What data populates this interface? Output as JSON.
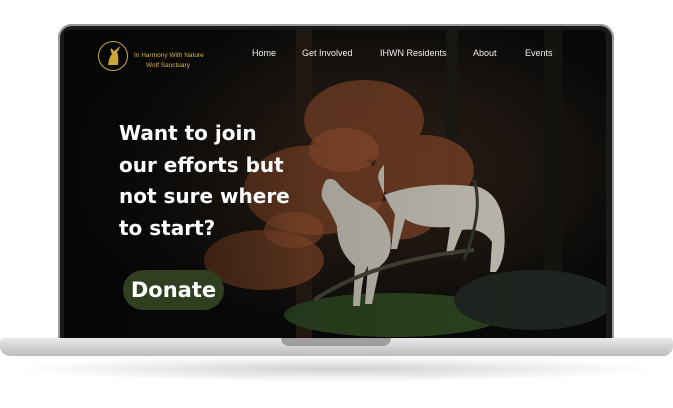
{
  "brand": {
    "name": "In Harmony With Nature",
    "tagline": "Wolf Sanctuary"
  },
  "nav": {
    "home": "Home",
    "get_involved": "Get Involved",
    "residents": "IHWN Residents",
    "about": "About",
    "events": "Events"
  },
  "hero": {
    "headline_lines": [
      "Want to join",
      "our efforts but",
      "not sure where",
      "to start?"
    ],
    "cta_label": "Donate"
  },
  "icons": {
    "logo": "howling-wolf-icon"
  },
  "colors": {
    "accent_gold": "#c9a53b",
    "button_green": "#2f3f1f",
    "screen_background": "#0b0d0c"
  }
}
